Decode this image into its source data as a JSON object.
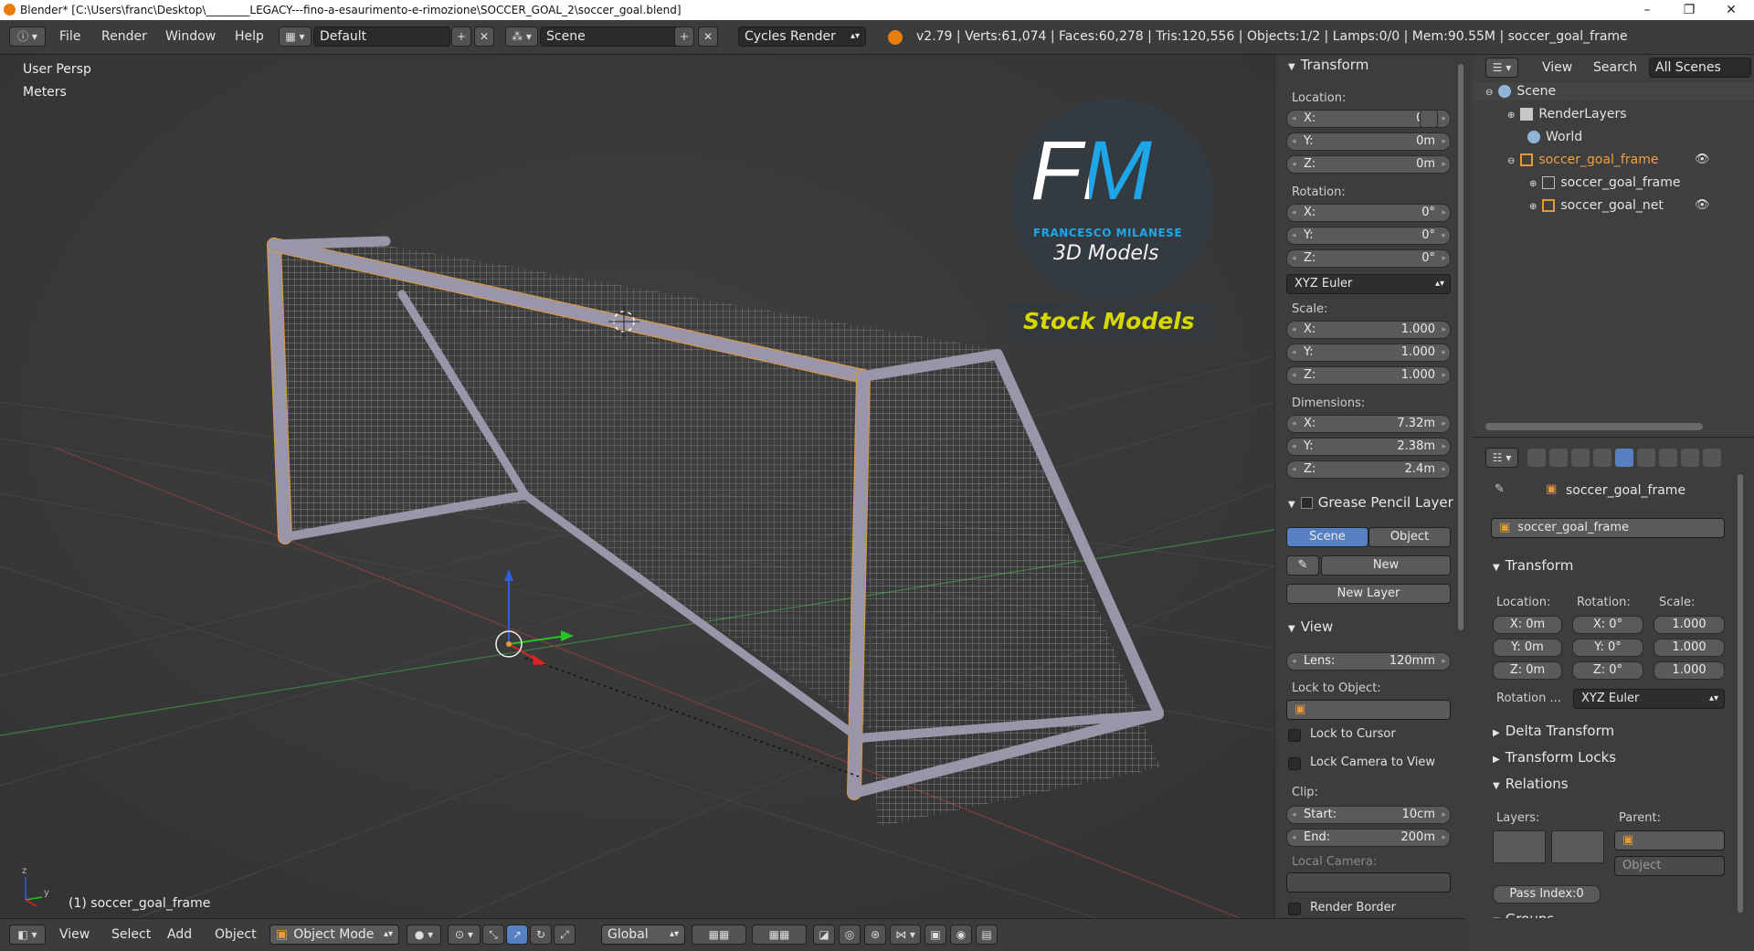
{
  "titlebar": {
    "title": "Blender* [C:\\Users\\franc\\Desktop\\________LEGACY---fino-a-esaurimento-e-rimozione\\SOCCER_GOAL_2\\soccer_goal.blend]",
    "minimize": "–",
    "maximize": "❐",
    "close": "✕"
  },
  "header": {
    "menus": [
      "File",
      "Render",
      "Window",
      "Help"
    ],
    "layout": "Default",
    "scene": "Scene",
    "engine": "Cycles Render",
    "stats": "v2.79 | Verts:61,074 | Faces:60,278 | Tris:120,556 | Objects:1/2 | Lamps:0/0 | Mem:90.55M | soccer_goal_frame"
  },
  "viewport": {
    "view_name": "User Persp",
    "units": "Meters",
    "active_object": "(1) soccer_goal_frame",
    "watermark": {
      "logo": "FM",
      "author": "FRANCESCO MILANESE",
      "subtitle": "3D Models",
      "banner": "Stock Models"
    }
  },
  "npanel": {
    "transform": {
      "title": "Transform",
      "location_label": "Location:",
      "location": [
        {
          "k": "X:",
          "v": "0m"
        },
        {
          "k": "Y:",
          "v": "0m"
        },
        {
          "k": "Z:",
          "v": "0m"
        }
      ],
      "rotation_label": "Rotation:",
      "rotation": [
        {
          "k": "X:",
          "v": "0°"
        },
        {
          "k": "Y:",
          "v": "0°"
        },
        {
          "k": "Z:",
          "v": "0°"
        }
      ],
      "rotation_mode": "XYZ Euler",
      "scale_label": "Scale:",
      "scale": [
        {
          "k": "X:",
          "v": "1.000"
        },
        {
          "k": "Y:",
          "v": "1.000"
        },
        {
          "k": "Z:",
          "v": "1.000"
        }
      ],
      "dimensions_label": "Dimensions:",
      "dimensions": [
        {
          "k": "X:",
          "v": "7.32m"
        },
        {
          "k": "Y:",
          "v": "2.38m"
        },
        {
          "k": "Z:",
          "v": "2.4m"
        }
      ]
    },
    "grease_pencil": {
      "title": "Grease Pencil Layer",
      "tab_scene": "Scene",
      "tab_object": "Object",
      "new": "New",
      "new_layer": "New Layer"
    },
    "view": {
      "title": "View",
      "lens_label": "Lens:",
      "lens": "120mm",
      "lock_to_object": "Lock to Object:",
      "lock_to_cursor": "Lock to Cursor",
      "lock_camera": "Lock Camera to View",
      "clip_label": "Clip:",
      "clip_start_label": "Start:",
      "clip_start": "10cm",
      "clip_end_label": "End:",
      "clip_end": "200m",
      "local_camera": "Local Camera:",
      "render_border": "Render Border"
    }
  },
  "outliner": {
    "view": "View",
    "search": "Search",
    "filter": "All Scenes",
    "items": [
      {
        "label": "Scene",
        "depth": 0
      },
      {
        "label": "RenderLayers",
        "depth": 1
      },
      {
        "label": "World",
        "depth": 1
      },
      {
        "label": "soccer_goal_frame",
        "depth": 1
      },
      {
        "label": "soccer_goal_frame",
        "depth": 2
      },
      {
        "label": "soccer_goal_net",
        "depth": 2
      }
    ]
  },
  "properties": {
    "breadcrumb_object": "soccer_goal_frame",
    "object_name": "soccer_goal_frame",
    "transform_title": "Transform",
    "location_label": "Location:",
    "rotation_label": "Rotation:",
    "scale_label": "Scale:",
    "location": [
      "X: 0m",
      "Y: 0m",
      "Z: 0m"
    ],
    "rotation": [
      "X:  0°",
      "Y:  0°",
      "Z:  0°"
    ],
    "scale": [
      "1.000",
      "1.000",
      "1.000"
    ],
    "rotation_mode_label": "Rotation ...",
    "rotation_mode": "XYZ Euler",
    "delta_transform": "Delta Transform",
    "transform_locks": "Transform Locks",
    "relations": "Relations",
    "layers_label": "Layers:",
    "parent_label": "Parent:",
    "parent_type": "Object",
    "pass_index": "Pass Index:0",
    "groups": "Groups"
  },
  "bottombar": {
    "menus": [
      "View",
      "Select",
      "Add",
      "Object"
    ],
    "mode": "Object Mode",
    "orientation": "Global"
  },
  "colors": {
    "accent_blue": "#5680c2",
    "selection_orange": "#f0a040",
    "watermark_yellow": "#d8d800"
  }
}
